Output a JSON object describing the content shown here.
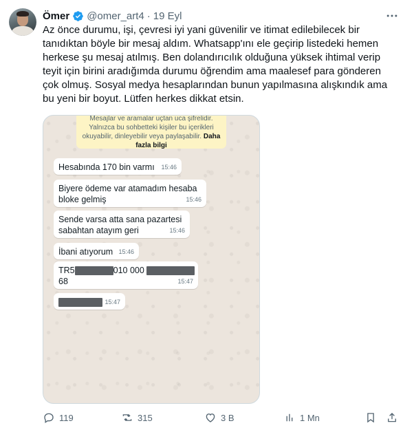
{
  "tweet": {
    "author_name": "Ömer",
    "handle": "@omer_art4",
    "separator": "·",
    "date": "19 Eyl",
    "text": "Az önce durumu, işi, çevresi iyi yani güvenilir ve itimat edilebilecek bir tanıdıktan böyle bir mesaj aldım. Whatsapp'ını ele geçirip listedeki hemen herkese şu mesaj atılmış. Ben dolandırıcılık olduğuna yüksek ihtimal verip teyit için birini aradığımda durumu öğrendim ama maalesef para gönderen çok olmuş. Sosyal medya hesaplarından bunun yapılmasına alışkındık ama bu yeni bir boyut. Lütfen herkes dikkat etsin.",
    "colors": {
      "verified": "#1d9bf0",
      "text": "#0f1419",
      "muted": "#536471"
    }
  },
  "chat": {
    "notice_line1": "Mesajlar ve aramalar uçtan uca şifrelidir.",
    "notice_line2": "Yalnızca bu sohbetteki kişiler bu içerikleri",
    "notice_line3": "okuyabilir, dinleyebilir veya paylaşabilir.",
    "notice_link1": "Daha",
    "notice_link2": "fazla bilgi",
    "messages": [
      {
        "text": "Hesabında 170 bin varmı",
        "time": "15:46"
      },
      {
        "line1": "Biyere ödeme var atamadım hesaba",
        "line2": "bloke gelmiş",
        "time": "15:46"
      },
      {
        "line1": "Sende varsa atta sana pazartesi",
        "line2": "sabahtan atayım geri",
        "time": "15:46"
      },
      {
        "text": "İbani atıyorum",
        "time": "15:46"
      },
      {
        "prefix": "TR5",
        "middle": "010 000",
        "line2": "68",
        "time": "15:47"
      },
      {
        "time": "15:47"
      }
    ]
  },
  "actions": {
    "reply_count": "119",
    "retweet_count": "315",
    "like_count": "3 B",
    "views_count": "1 Mn",
    "icons": [
      "reply-icon",
      "retweet-icon",
      "like-icon",
      "views-icon",
      "bookmark-icon",
      "share-icon"
    ]
  }
}
